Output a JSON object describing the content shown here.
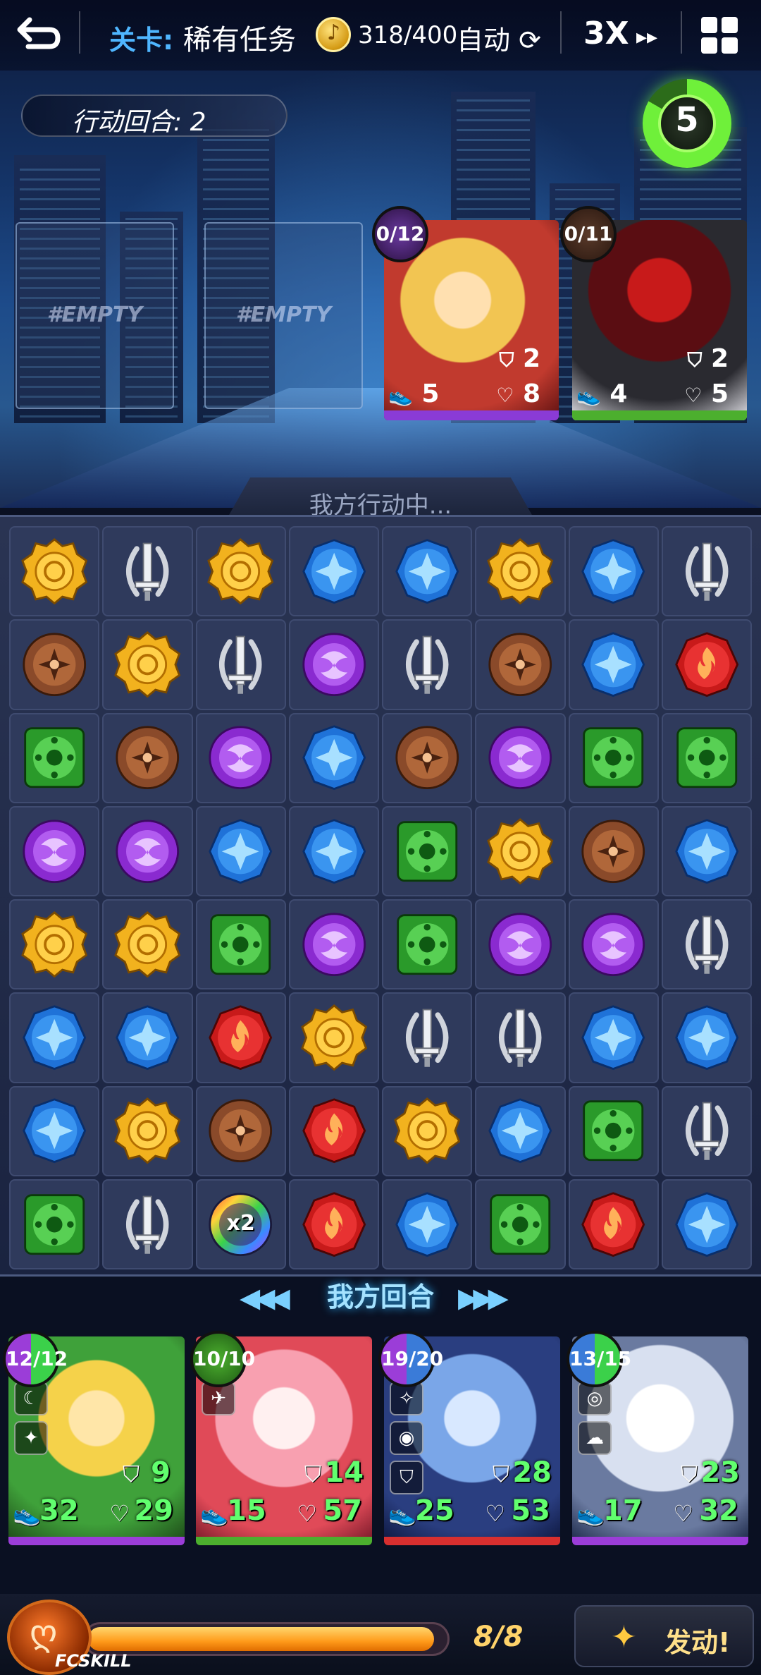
{
  "topbar": {
    "level_label": "关卡:",
    "level_name": "稀有任务",
    "coins": "318/400",
    "auto": "自动",
    "speed": "3X"
  },
  "turn_counter": "行动回合: 2",
  "timer": "5",
  "empty_slots": [
    "#EMPTY",
    "#EMPTY"
  ],
  "enemies": [
    {
      "count": "0/12",
      "shield": "2",
      "speed": "5",
      "hp": "8",
      "bar_color": "#8a3bd6",
      "count_color": "#5a2a8a"
    },
    {
      "count": "0/11",
      "shield": "2",
      "speed": "4",
      "hp": "5",
      "bar_color": "#4caf2e",
      "count_color": "#3b2a1a"
    }
  ],
  "status": "我方行动中...",
  "my_turn": "我方回合",
  "board": [
    [
      "yellow",
      "sword",
      "yellow",
      "blue",
      "blue",
      "yellow",
      "blue",
      "sword"
    ],
    [
      "brown",
      "yellow",
      "sword",
      "purple",
      "sword",
      "brown",
      "blue",
      "red"
    ],
    [
      "green",
      "brown",
      "purple",
      "blue",
      "brown",
      "purple",
      "green",
      "green"
    ],
    [
      "purple",
      "purple",
      "blue",
      "blue",
      "green",
      "yellow",
      "brown",
      "blue"
    ],
    [
      "yellow",
      "yellow",
      "green",
      "purple",
      "green",
      "purple",
      "purple",
      "sword"
    ],
    [
      "blue",
      "blue",
      "red",
      "yellow",
      "sword",
      "sword",
      "blue",
      "blue"
    ],
    [
      "blue",
      "yellow",
      "brown",
      "red",
      "yellow",
      "blue",
      "green",
      "sword"
    ],
    [
      "green",
      "sword",
      "rainbow",
      "red",
      "blue",
      "green",
      "red",
      "blue"
    ]
  ],
  "rainbow_label": "x2",
  "heroes": [
    {
      "count": "12/12",
      "shield": "9",
      "speed": "32",
      "hp": "29",
      "bar_color": "#9b3dd8"
    },
    {
      "count": "10/10",
      "shield": "14",
      "speed": "15",
      "hp": "57",
      "bar_color": "#4caf2e"
    },
    {
      "count": "19/20",
      "shield": "28",
      "speed": "25",
      "hp": "53",
      "bar_color": "#d82f2f"
    },
    {
      "count": "13/15",
      "shield": "23",
      "speed": "17",
      "hp": "32",
      "bar_color": "#9b3dd8"
    }
  ],
  "bottom": {
    "fc_label": "FCSKILL",
    "energy": "8/8",
    "energy_fraction": 0.97,
    "activate": "发动!"
  }
}
